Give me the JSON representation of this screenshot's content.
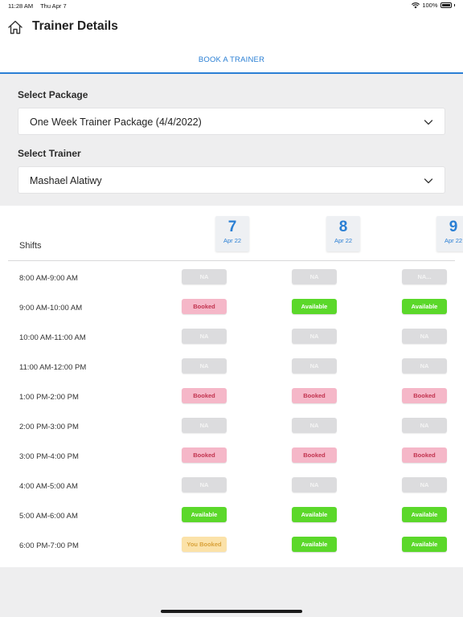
{
  "status_bar": {
    "time": "11:28 AM",
    "date": "Thu Apr 7",
    "battery": "100%"
  },
  "header": {
    "title": "Trainer Details"
  },
  "tabs": [
    {
      "label": "BOOK A TRAINER"
    }
  ],
  "package": {
    "label": "Select Package",
    "value": "One Week Trainer Package (4/4/2022)"
  },
  "trainer": {
    "label": "Select Trainer",
    "value": "Mashael Alatiwy"
  },
  "schedule": {
    "shifts_label": "Shifts",
    "days": [
      {
        "day": "7",
        "month": "Apr 22"
      },
      {
        "day": "8",
        "month": "Apr 22"
      },
      {
        "day": "9",
        "month": "Apr 22"
      }
    ],
    "rows": [
      {
        "time": "8:00 AM-9:00 AM",
        "slots": [
          {
            "status": "na",
            "label": "NA"
          },
          {
            "status": "na",
            "label": "NA"
          },
          {
            "status": "na",
            "label": "NA..."
          }
        ]
      },
      {
        "time": "9:00 AM-10:00 AM",
        "slots": [
          {
            "status": "booked",
            "label": "Booked"
          },
          {
            "status": "available",
            "label": "Available"
          },
          {
            "status": "available",
            "label": "Available"
          }
        ]
      },
      {
        "time": "10:00 AM-11:00 AM",
        "slots": [
          {
            "status": "na",
            "label": "NA"
          },
          {
            "status": "na",
            "label": "NA"
          },
          {
            "status": "na",
            "label": "NA"
          }
        ]
      },
      {
        "time": "11:00 AM-12:00 PM",
        "slots": [
          {
            "status": "na",
            "label": "NA"
          },
          {
            "status": "na",
            "label": "NA"
          },
          {
            "status": "na",
            "label": "NA"
          }
        ]
      },
      {
        "time": "1:00 PM-2:00 PM",
        "slots": [
          {
            "status": "booked",
            "label": "Booked"
          },
          {
            "status": "booked",
            "label": "Booked"
          },
          {
            "status": "booked",
            "label": "Booked"
          }
        ]
      },
      {
        "time": "2:00 PM-3:00 PM",
        "slots": [
          {
            "status": "na",
            "label": "NA"
          },
          {
            "status": "na",
            "label": "NA"
          },
          {
            "status": "na",
            "label": "NA"
          }
        ]
      },
      {
        "time": "3:00 PM-4:00 PM",
        "slots": [
          {
            "status": "booked",
            "label": "Booked"
          },
          {
            "status": "booked",
            "label": "Booked"
          },
          {
            "status": "booked",
            "label": "Booked"
          }
        ]
      },
      {
        "time": "4:00 AM-5:00 AM",
        "slots": [
          {
            "status": "na",
            "label": "NA"
          },
          {
            "status": "na",
            "label": "NA"
          },
          {
            "status": "na",
            "label": "NA"
          }
        ]
      },
      {
        "time": "5:00 AM-6:00 AM",
        "slots": [
          {
            "status": "available",
            "label": "Available"
          },
          {
            "status": "available",
            "label": "Available"
          },
          {
            "status": "available",
            "label": "Available"
          }
        ]
      },
      {
        "time": "6:00 PM-7:00 PM",
        "slots": [
          {
            "status": "you",
            "label": "You Booked"
          },
          {
            "status": "available",
            "label": "Available"
          },
          {
            "status": "available",
            "label": "Available"
          }
        ]
      }
    ]
  },
  "colors": {
    "accent": "#2a7fd4",
    "available": "#5bd82a",
    "booked": "#f5b7c8",
    "you_booked": "#fbe2a9",
    "na": "#dcdcde"
  },
  "icons": {
    "home": "home-icon",
    "dropdown": "chevron-down-icon",
    "wifi": "wifi-icon",
    "battery": "battery-icon"
  }
}
